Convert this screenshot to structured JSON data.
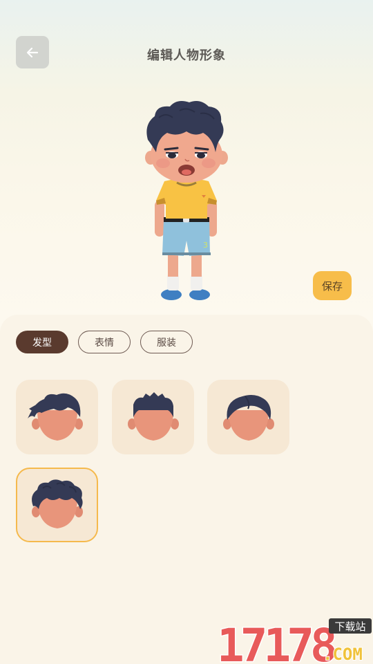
{
  "header": {
    "title": "编辑人物形象"
  },
  "actions": {
    "save_label": "保存"
  },
  "tabs": [
    {
      "label": "发型",
      "active": true
    },
    {
      "label": "表情",
      "active": false
    },
    {
      "label": "服装",
      "active": false
    }
  ],
  "hairstyles": [
    {
      "id": "hair-1",
      "selected": false
    },
    {
      "id": "hair-2",
      "selected": false
    },
    {
      "id": "hair-3",
      "selected": false
    },
    {
      "id": "hair-4",
      "selected": true
    }
  ],
  "watermark": {
    "number": "17178",
    "badge": "下载站",
    "domain": ".COM"
  },
  "colors": {
    "accent": "#f7bd4a",
    "tab_active": "#5a3a2e",
    "card_bg": "#f6e8d4",
    "hair": "#343a55",
    "skin": "#e8957b"
  }
}
